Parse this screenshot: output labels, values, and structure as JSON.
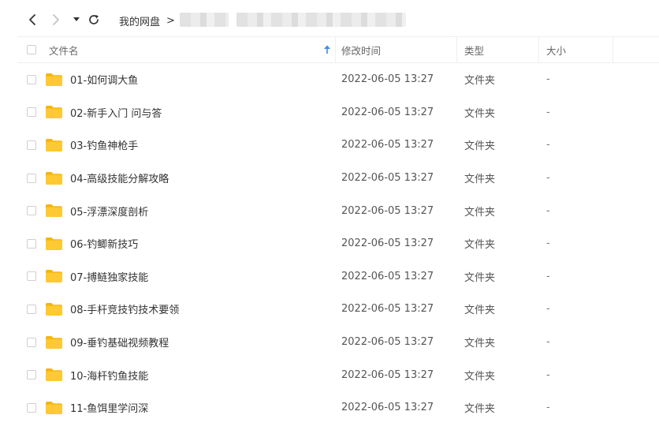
{
  "nav": {
    "back_icon": "chevron-left-icon",
    "forward_icon": "chevron-right-icon",
    "dropdown_icon": "caret-down-icon",
    "refresh_icon": "refresh-icon"
  },
  "breadcrumb": {
    "root": "我的网盘",
    "separator": ">"
  },
  "table": {
    "headers": {
      "name": "文件名",
      "modified": "修改时间",
      "type": "类型",
      "size": "大小"
    },
    "sort_icon": "arrow-up-icon",
    "rows": [
      {
        "name": "01-如何调大鱼",
        "modified": "2022-06-05 13:27",
        "type": "文件夹",
        "size": "-"
      },
      {
        "name": "02-新手入门 问与答",
        "modified": "2022-06-05 13:27",
        "type": "文件夹",
        "size": "-"
      },
      {
        "name": "03-钓鱼神枪手",
        "modified": "2022-06-05 13:27",
        "type": "文件夹",
        "size": "-"
      },
      {
        "name": "04-高级技能分解攻略",
        "modified": "2022-06-05 13:27",
        "type": "文件夹",
        "size": "-"
      },
      {
        "name": "05-浮漂深度剖析",
        "modified": "2022-06-05 13:27",
        "type": "文件夹",
        "size": "-"
      },
      {
        "name": "06-钓鲫新技巧",
        "modified": "2022-06-05 13:27",
        "type": "文件夹",
        "size": "-"
      },
      {
        "name": "07-搏鲢独家技能",
        "modified": "2022-06-05 13:27",
        "type": "文件夹",
        "size": "-"
      },
      {
        "name": "08-手杆竞技钓技术要领",
        "modified": "2022-06-05 13:27",
        "type": "文件夹",
        "size": "-"
      },
      {
        "name": "09-垂钓基础视频教程",
        "modified": "2022-06-05 13:27",
        "type": "文件夹",
        "size": "-"
      },
      {
        "name": "10-海杆钓鱼技能",
        "modified": "2022-06-05 13:27",
        "type": "文件夹",
        "size": "-"
      },
      {
        "name": "11-鱼饵里学问深",
        "modified": "2022-06-05 13:27",
        "type": "文件夹",
        "size": "-"
      }
    ]
  },
  "colors": {
    "folder": "#FFC933",
    "folder_tab": "#F5B50F",
    "sort_arrow": "#3A8EE6"
  }
}
